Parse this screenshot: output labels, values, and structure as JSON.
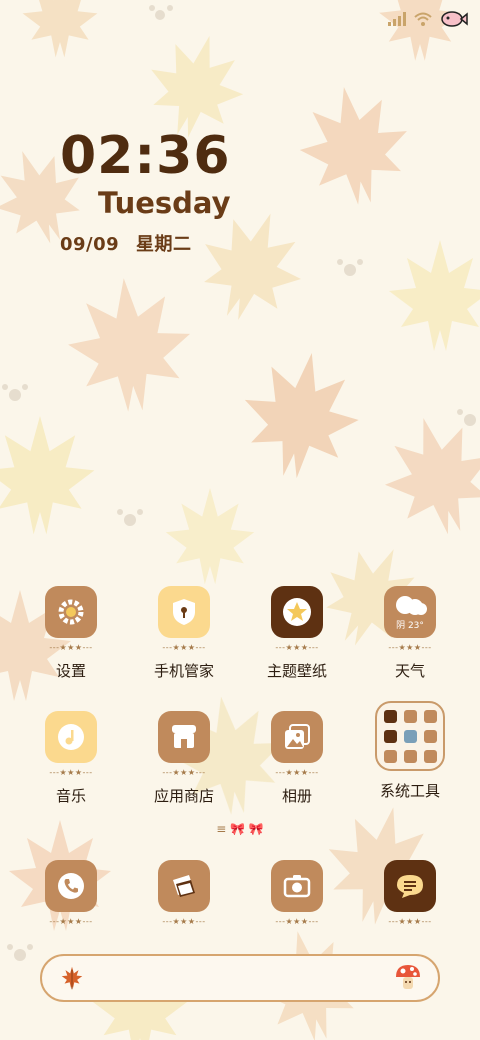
{
  "clock": {
    "time": "02:36",
    "weekday": "Tuesday",
    "date": "09/09",
    "weekday_cn": "星期二"
  },
  "status_bar": {
    "icons": [
      "signal-icon",
      "wifi-icon",
      "battery-fish-icon"
    ]
  },
  "apps": [
    {
      "label": "设置",
      "icon": "settings-icon",
      "stars": "---★★★---"
    },
    {
      "label": "手机管家",
      "icon": "shield-icon",
      "stars": "---★★★---"
    },
    {
      "label": "主题壁纸",
      "icon": "theme-star-icon",
      "stars": "---★★★---"
    },
    {
      "label": "天气",
      "icon": "weather-icon",
      "stars": "---★★★---",
      "weather_text": "阴 23°"
    },
    {
      "label": "音乐",
      "icon": "music-icon",
      "stars": "---★★★---"
    },
    {
      "label": "应用商店",
      "icon": "store-icon",
      "stars": "---★★★---"
    },
    {
      "label": "相册",
      "icon": "gallery-icon",
      "stars": "---★★★---"
    },
    {
      "label": "系统工具",
      "icon": "folder-icon"
    }
  ],
  "page_indicator": "≡ 🎀 🎀",
  "dock_apps": [
    {
      "icon": "phone-icon",
      "stars": "---★★★---"
    },
    {
      "icon": "notes-icon",
      "stars": "---★★★---"
    },
    {
      "icon": "camera-icon",
      "stars": "---★★★---"
    },
    {
      "icon": "message-icon",
      "stars": "---★★★---"
    }
  ],
  "search_bar": {
    "left_icon": "maple-leaf-icon",
    "right_icon": "mushroom-icon"
  }
}
